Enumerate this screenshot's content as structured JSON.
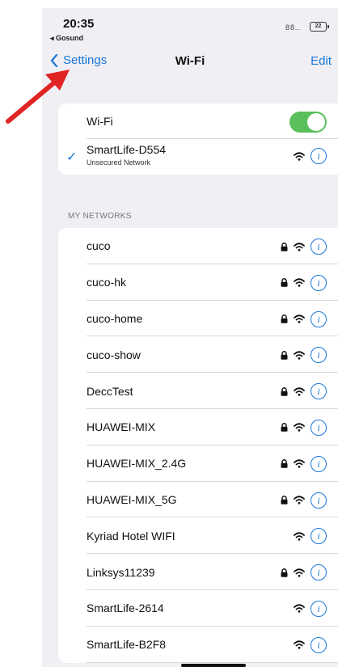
{
  "status": {
    "time": "20:35",
    "back_app": "◂ Gosund",
    "signal": "88..",
    "battery": "22"
  },
  "nav": {
    "back_label": "Settings",
    "title": "Wi-Fi",
    "edit_label": "Edit"
  },
  "wifi": {
    "label": "Wi-Fi",
    "enabled": true
  },
  "connected": {
    "name": "SmartLife-D554",
    "sub": "Unsecured Network"
  },
  "section_header": "MY NETWORKS",
  "networks": [
    {
      "name": "cuco",
      "locked": true
    },
    {
      "name": "cuco-hk",
      "locked": true
    },
    {
      "name": "cuco-home",
      "locked": true
    },
    {
      "name": "cuco-show",
      "locked": true
    },
    {
      "name": "DeccTest",
      "locked": true
    },
    {
      "name": "HUAWEI-MIX",
      "locked": true
    },
    {
      "name": "HUAWEI-MIX_2.4G",
      "locked": true
    },
    {
      "name": "HUAWEI-MIX_5G",
      "locked": true
    },
    {
      "name": "Kyriad Hotel WIFI",
      "locked": false
    },
    {
      "name": "Linksys11239",
      "locked": true
    },
    {
      "name": "SmartLife-2614",
      "locked": false
    },
    {
      "name": "SmartLife-B2F8",
      "locked": false
    }
  ],
  "colors": {
    "accent": "#1a76d8",
    "toggle_on": "#5ac05c",
    "arrow": "#e02424"
  }
}
